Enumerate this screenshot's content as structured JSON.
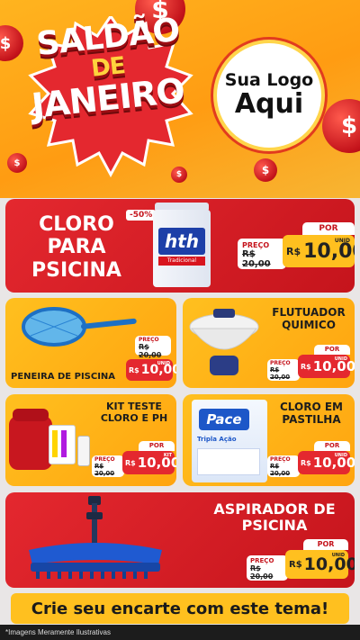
{
  "hero": {
    "title_line1": "SALDÃO",
    "title_line2": "DE",
    "title_line3": "JANEIRO",
    "logo_line1": "Sua Logo",
    "logo_line2": "Aqui",
    "coin_symbol": "$"
  },
  "products": [
    {
      "name": "CLORO PARA PSICINA",
      "name_lines": [
        "CLORO",
        "PARA",
        "PSICINA"
      ],
      "discount": "-50%",
      "old_label": "PREÇO",
      "old_price": "R$ 20,00",
      "por": "POR",
      "currency": "R$",
      "price": "10,00",
      "unit": "UNID",
      "product_label": "hth",
      "product_sub": "Tradicional"
    },
    {
      "name": "PENEIRA DE PISCINA",
      "old_label": "PREÇO",
      "old_price": "R$ 20,00",
      "currency": "R$",
      "price": "10,00",
      "unit": "UNID"
    },
    {
      "name_lines": [
        "FLUTUADOR",
        "QUIMICO"
      ],
      "old_label": "PREÇO",
      "old_price": "R$ 20,00",
      "por": "POR",
      "currency": "R$",
      "price": "10,00",
      "unit": "UNID"
    },
    {
      "name_lines": [
        "KIT TESTE",
        "CLORO E PH"
      ],
      "old_label": "PREÇO",
      "old_price": "R$ 20,00",
      "por": "POR",
      "currency": "R$",
      "price": "10,00",
      "unit": "KIT"
    },
    {
      "name_lines": [
        "CLORO EM",
        "PASTILHA"
      ],
      "old_label": "PREÇO",
      "old_price": "R$ 20,00",
      "por": "POR",
      "currency": "R$",
      "price": "10,00",
      "unit": "UNID",
      "product_label": "Pace",
      "product_sub": "Tripla Ação"
    },
    {
      "name_lines": [
        "ASPIRADOR DE",
        "PSICINA"
      ],
      "old_label": "PREÇO",
      "old_price": "R$ 20,00",
      "por": "POR",
      "currency": "R$",
      "price": "10,00",
      "unit": "UNID"
    }
  ],
  "footer": {
    "cta": "Crie seu encarte com este tema!",
    "disclaimer": "*Imagens Meramente Ilustrativas"
  }
}
